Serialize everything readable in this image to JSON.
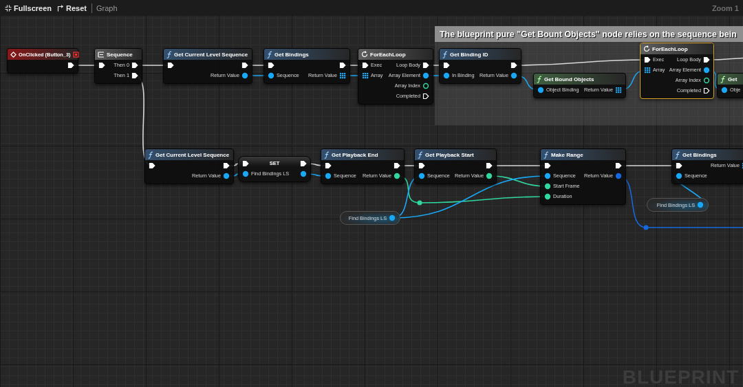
{
  "toolbar": {
    "items": [
      {
        "kind": "fullscreen",
        "label": "Fullscreen"
      },
      {
        "kind": "reset",
        "label": "Reset"
      }
    ],
    "breadcrumb": "Graph",
    "zoom": "Zoom 1"
  },
  "graph": {
    "comment": {
      "text": "The blueprint pure \"Get Bount Objects\" node relies on the sequence bein"
    },
    "nodes": [
      {
        "kind": "event",
        "title": "OnClicked (Button_3)",
        "selected": false,
        "outputs": [
          {
            "kind": "exec",
            "connected": true
          }
        ]
      },
      {
        "kind": "sequence",
        "title": "Sequence",
        "selected": false,
        "inputs": [
          {
            "kind": "exec",
            "connected": true
          }
        ],
        "outputs": [
          {
            "kind": "exec",
            "label": "Then 0",
            "connected": true
          },
          {
            "kind": "exec",
            "label": "Then 1",
            "connected": true
          }
        ]
      },
      {
        "kind": "function",
        "title": "Get Current Level Sequence",
        "selected": false,
        "inputs": [
          {
            "kind": "exec",
            "connected": true
          }
        ],
        "outputs": [
          {
            "kind": "exec",
            "connected": true
          },
          {
            "kind": "object",
            "label": "Return Value",
            "connected": true
          }
        ]
      },
      {
        "kind": "function",
        "title": "Get Bindings",
        "selected": false,
        "inputs": [
          {
            "kind": "exec",
            "connected": true
          },
          {
            "kind": "object",
            "label": "Sequence",
            "connected": true
          }
        ],
        "outputs": [
          {
            "kind": "exec",
            "connected": true
          },
          {
            "kind": "array",
            "label": "Return Value",
            "connected": true
          }
        ]
      },
      {
        "kind": "loop",
        "title": "ForEachLoop",
        "selected": false,
        "inputs": [
          {
            "kind": "exec",
            "label": "Exec",
            "connected": true
          },
          {
            "kind": "array",
            "label": "Array",
            "connected": true
          }
        ],
        "outputs": [
          {
            "kind": "exec",
            "label": "Loop Body",
            "connected": true
          },
          {
            "kind": "object",
            "label": "Array Element",
            "connected": true
          },
          {
            "kind": "int",
            "label": "Array Index",
            "connected": false
          },
          {
            "kind": "exec",
            "label": "Completed",
            "connected": false
          }
        ]
      },
      {
        "kind": "function",
        "title": "Get Binding ID",
        "selected": false,
        "inputs": [
          {
            "kind": "exec",
            "connected": true
          },
          {
            "kind": "object",
            "label": "In Binding",
            "connected": true
          }
        ],
        "outputs": [
          {
            "kind": "exec",
            "connected": true
          },
          {
            "kind": "object",
            "label": "Return Value",
            "connected": true
          }
        ]
      },
      {
        "kind": "pure",
        "title": "Get Bound Objects",
        "selected": false,
        "inputs": [
          {
            "kind": "object",
            "label": "Object Binding",
            "connected": true
          }
        ],
        "outputs": [
          {
            "kind": "array",
            "label": "Return Value",
            "connected": true
          }
        ]
      },
      {
        "kind": "loop",
        "title": "ForEachLoop",
        "selected": true,
        "inputs": [
          {
            "kind": "exec",
            "label": "Exec",
            "connected": true
          },
          {
            "kind": "array",
            "label": "Array",
            "connected": true
          }
        ],
        "outputs": [
          {
            "kind": "exec",
            "label": "Loop Body",
            "connected": true
          },
          {
            "kind": "object",
            "label": "Array Element",
            "connected": true
          },
          {
            "kind": "int",
            "label": "Array Index",
            "connected": false
          },
          {
            "kind": "exec",
            "label": "Completed",
            "connected": false
          }
        ]
      },
      {
        "kind": "pure",
        "title": "Get",
        "selected": false,
        "inputs": [
          {
            "kind": "object",
            "label": "Obje",
            "connected": true
          }
        ]
      },
      {
        "kind": "function",
        "title": "Get Current Level Sequence",
        "selected": false,
        "inputs": [
          {
            "kind": "exec",
            "connected": true
          }
        ],
        "outputs": [
          {
            "kind": "exec",
            "connected": true
          },
          {
            "kind": "object",
            "label": "Return Value",
            "connected": true
          }
        ]
      },
      {
        "kind": "set",
        "title": "SET",
        "selected": false,
        "inputs": [
          {
            "kind": "exec",
            "connected": true
          },
          {
            "kind": "object",
            "label": "Find Bindings LS",
            "connected": true
          }
        ],
        "outputs": [
          {
            "kind": "exec",
            "connected": true
          },
          {
            "kind": "object",
            "connected": true
          }
        ]
      },
      {
        "kind": "function",
        "title": "Get Playback End",
        "selected": false,
        "inputs": [
          {
            "kind": "exec",
            "connected": true
          },
          {
            "kind": "object",
            "label": "Sequence",
            "connected": true
          }
        ],
        "outputs": [
          {
            "kind": "exec",
            "connected": true
          },
          {
            "kind": "int",
            "label": "Return Value",
            "connected": true
          }
        ]
      },
      {
        "kind": "function",
        "title": "Get Playback Start",
        "selected": false,
        "inputs": [
          {
            "kind": "exec",
            "connected": true
          },
          {
            "kind": "object",
            "label": "Sequence",
            "connected": true
          }
        ],
        "outputs": [
          {
            "kind": "exec",
            "connected": true
          },
          {
            "kind": "int",
            "label": "Return Value",
            "connected": true
          }
        ]
      },
      {
        "kind": "function",
        "title": "Make Range",
        "selected": false,
        "inputs": [
          {
            "kind": "exec",
            "connected": true
          },
          {
            "kind": "object",
            "label": "Sequence",
            "connected": true
          },
          {
            "kind": "int",
            "label": "Start Frame",
            "connected": true
          },
          {
            "kind": "int",
            "label": "Duration",
            "connected": true
          }
        ],
        "outputs": [
          {
            "kind": "exec",
            "connected": true
          },
          {
            "kind": "range",
            "label": "Return Value",
            "connected": true
          }
        ]
      },
      {
        "kind": "function",
        "title": "Get Bindings",
        "selected": false,
        "inputs": [
          {
            "kind": "exec",
            "connected": true
          },
          {
            "kind": "object",
            "label": "Sequence",
            "connected": true
          }
        ],
        "outputs": [
          {
            "kind": "array",
            "label": "Return Value",
            "connected": true
          }
        ]
      },
      {
        "kind": "variable",
        "selected": false,
        "outputs": [
          {
            "kind": "object",
            "label": "Find Bindings LS",
            "connected": true
          }
        ]
      },
      {
        "kind": "variable",
        "selected": false,
        "outputs": [
          {
            "kind": "object",
            "label": "Find Bindings LS",
            "connected": true
          }
        ]
      }
    ],
    "graph_type_label": "BLUEPRINT"
  }
}
